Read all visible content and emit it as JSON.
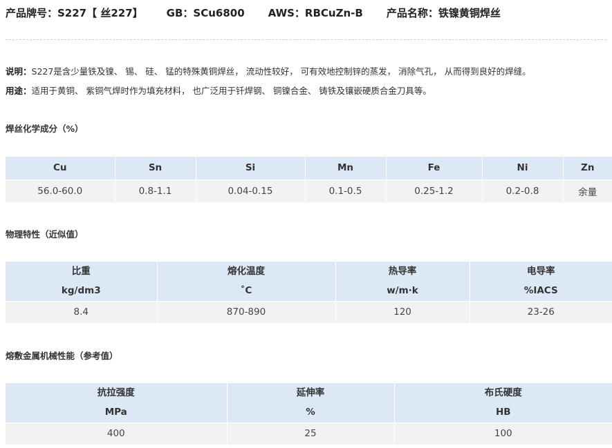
{
  "header": {
    "product_no": "产品牌号：S227【 丝227】",
    "gb": "GB：SCu6800",
    "aws": "AWS：RBCuZn-B",
    "product_name": "产品名称：铁镍黄铜焊丝"
  },
  "description": {
    "label": "说明：",
    "text": "S227是含少量铁及镍、 锡、 硅、 锰的特殊黄铜焊丝， 流动性较好， 可有效地控制锌的蒸发， 消除气孔， 从而得到良好的焊缝。"
  },
  "usage": {
    "label": "用途：",
    "text": "适用于黄铜、 紫铜气焊时作为填充材料， 也广泛用于钎焊钢、 铜镍合金、 铸铁及镶嵌硬质合金刀具等。"
  },
  "composition": {
    "title": "焊丝化学成分（%）",
    "headers": [
      "Cu",
      "Sn",
      "Si",
      "Mn",
      "Fe",
      "Ni",
      "Zn"
    ],
    "values": [
      "56.0-60.0",
      "0.8-1.1",
      "0.04-0.15",
      "0.1-0.5",
      "0.25-1.2",
      "0.2-0.8",
      "余量"
    ]
  },
  "physical": {
    "title": "物理特性（近似值）",
    "headers": [
      {
        "name": "比重",
        "unit": "kg/dm3"
      },
      {
        "name": "熔化温度",
        "unit": "˚C"
      },
      {
        "name": "热导率",
        "unit": "w/m·k"
      },
      {
        "name": "电导率",
        "unit": "%IACS"
      }
    ],
    "values": [
      "8.4",
      "870-890",
      "120",
      "23-26"
    ]
  },
  "mechanical": {
    "title": "熔敷金属机械性能（参考值）",
    "headers": [
      {
        "name": "抗拉强度",
        "unit": "MPa"
      },
      {
        "name": "延伸率",
        "unit": "%"
      },
      {
        "name": "布氏硬度",
        "unit": "HB"
      }
    ],
    "values": [
      "400",
      "25",
      "100"
    ]
  }
}
